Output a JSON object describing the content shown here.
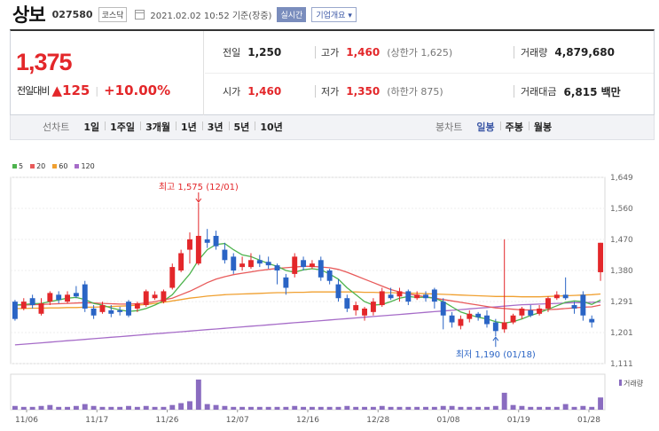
{
  "header": {
    "name": "상보",
    "code": "027580",
    "market": "코스닥",
    "datetime": "2021.02.02 10:52 기준(장중)",
    "realtime": "실시간",
    "overview": "기업개요"
  },
  "price": {
    "current": "1,375",
    "change_label": "전일대비",
    "change": "▲125",
    "change_pct": "+10.00%"
  },
  "info": {
    "prev_label": "전일",
    "prev": "1,250",
    "high_label": "고가",
    "high": "1,460",
    "high_sub": "(상한가 1,625)",
    "volume_label": "거래량",
    "volume": "4,879,680",
    "open_label": "시가",
    "open": "1,460",
    "low_label": "저가",
    "low": "1,350",
    "low_sub": "(하한가 875)",
    "amount_label": "거래대금",
    "amount": "6,815 백만"
  },
  "tabs": {
    "line_label": "선차트",
    "line_items": [
      "1일",
      "1주일",
      "3개월",
      "1년",
      "3년",
      "5년",
      "10년"
    ],
    "candle_label": "봉차트",
    "candle_items": [
      "일봉",
      "주봉",
      "월봉"
    ],
    "candle_active": "일봉"
  },
  "colors": {
    "up": "#e3272a",
    "down": "#2a64c5",
    "ma5": "#4db34d",
    "ma20": "#e85a5a",
    "ma60": "#f0a030",
    "ma120": "#a66cc8",
    "volume": "#8a6cc0"
  },
  "chart_data": {
    "type": "candlestick",
    "legend": [
      "5",
      "20",
      "60",
      "120"
    ],
    "yticks": [
      "1,649",
      "1,560",
      "1,470",
      "1,380",
      "1,291",
      "1,201",
      "1,111"
    ],
    "ylim": [
      1111,
      1649
    ],
    "xlabels": [
      "11/06",
      "11/17",
      "11/26",
      "12/07",
      "12/16",
      "12/28",
      "01/08",
      "01/19",
      "01/28"
    ],
    "max_annotation": "최고 1,575 (12/01)",
    "min_annotation": "최저 1,190 (01/18)",
    "volume_label": "거래량",
    "candles": [
      [
        1290,
        1240,
        1295,
        1235
      ],
      [
        1270,
        1290,
        1300,
        1265
      ],
      [
        1300,
        1280,
        1310,
        1270
      ],
      [
        1255,
        1285,
        1300,
        1250
      ],
      [
        1290,
        1315,
        1320,
        1280
      ],
      [
        1310,
        1295,
        1320,
        1285
      ],
      [
        1290,
        1310,
        1320,
        1285
      ],
      [
        1315,
        1305,
        1335,
        1300
      ],
      [
        1340,
        1270,
        1350,
        1260
      ],
      [
        1270,
        1250,
        1280,
        1240
      ],
      [
        1260,
        1280,
        1290,
        1255
      ],
      [
        1265,
        1255,
        1280,
        1245
      ],
      [
        1265,
        1260,
        1275,
        1250
      ],
      [
        1290,
        1250,
        1295,
        1245
      ],
      [
        1270,
        1285,
        1290,
        1260
      ],
      [
        1280,
        1320,
        1325,
        1275
      ],
      [
        1300,
        1310,
        1320,
        1295
      ],
      [
        1290,
        1320,
        1325,
        1285
      ],
      [
        1330,
        1390,
        1400,
        1325
      ],
      [
        1380,
        1430,
        1440,
        1375
      ],
      [
        1440,
        1470,
        1490,
        1400
      ],
      [
        1400,
        1480,
        1575,
        1395
      ],
      [
        1470,
        1460,
        1500,
        1445
      ],
      [
        1480,
        1450,
        1495,
        1440
      ],
      [
        1440,
        1410,
        1460,
        1400
      ],
      [
        1420,
        1380,
        1430,
        1370
      ],
      [
        1390,
        1400,
        1420,
        1380
      ],
      [
        1390,
        1410,
        1430,
        1385
      ],
      [
        1410,
        1400,
        1425,
        1390
      ],
      [
        1405,
        1395,
        1420,
        1385
      ],
      [
        1395,
        1380,
        1400,
        1340
      ],
      [
        1360,
        1330,
        1370,
        1310
      ],
      [
        1370,
        1420,
        1430,
        1360
      ],
      [
        1410,
        1390,
        1420,
        1380
      ],
      [
        1390,
        1400,
        1410,
        1385
      ],
      [
        1410,
        1360,
        1420,
        1350
      ],
      [
        1380,
        1350,
        1385,
        1340
      ],
      [
        1340,
        1300,
        1355,
        1290
      ],
      [
        1300,
        1270,
        1310,
        1260
      ],
      [
        1265,
        1280,
        1290,
        1250
      ],
      [
        1250,
        1270,
        1275,
        1235
      ],
      [
        1260,
        1290,
        1300,
        1250
      ],
      [
        1280,
        1320,
        1330,
        1275
      ],
      [
        1310,
        1300,
        1330,
        1295
      ],
      [
        1305,
        1320,
        1330,
        1290
      ],
      [
        1320,
        1290,
        1325,
        1280
      ],
      [
        1300,
        1310,
        1320,
        1295
      ],
      [
        1310,
        1300,
        1320,
        1290
      ],
      [
        1325,
        1290,
        1330,
        1270
      ],
      [
        1290,
        1250,
        1300,
        1210
      ],
      [
        1250,
        1230,
        1260,
        1215
      ],
      [
        1220,
        1240,
        1250,
        1210
      ],
      [
        1240,
        1255,
        1265,
        1230
      ],
      [
        1255,
        1245,
        1260,
        1235
      ],
      [
        1250,
        1225,
        1265,
        1215
      ],
      [
        1230,
        1205,
        1240,
        1190
      ],
      [
        1210,
        1230,
        1470,
        1200
      ],
      [
        1230,
        1250,
        1255,
        1225
      ],
      [
        1250,
        1270,
        1275,
        1240
      ],
      [
        1265,
        1250,
        1280,
        1245
      ],
      [
        1255,
        1270,
        1280,
        1250
      ],
      [
        1270,
        1300,
        1305,
        1260
      ],
      [
        1300,
        1310,
        1320,
        1295
      ],
      [
        1310,
        1300,
        1360,
        1295
      ],
      [
        1280,
        1270,
        1290,
        1255
      ],
      [
        1310,
        1250,
        1320,
        1235
      ],
      [
        1240,
        1230,
        1250,
        1215
      ],
      [
        1375,
        1460,
        1460,
        1350
      ]
    ],
    "ma5": [
      1280,
      1282,
      1284,
      1285,
      1290,
      1295,
      1300,
      1302,
      1296,
      1285,
      1280,
      1272,
      1266,
      1262,
      1264,
      1270,
      1280,
      1292,
      1310,
      1340,
      1370,
      1410,
      1440,
      1455,
      1458,
      1440,
      1425,
      1420,
      1410,
      1400,
      1392,
      1380,
      1375,
      1382,
      1385,
      1382,
      1370,
      1355,
      1330,
      1310,
      1290,
      1280,
      1282,
      1290,
      1300,
      1305,
      1302,
      1303,
      1300,
      1290,
      1275,
      1260,
      1252,
      1245,
      1240,
      1232,
      1228,
      1232,
      1240,
      1250,
      1258,
      1268,
      1278,
      1288,
      1292,
      1290,
      1282,
      1295
    ],
    "ma20": [
      1280,
      1280,
      1281,
      1282,
      1283,
      1284,
      1285,
      1286,
      1287,
      1286,
      1285,
      1284,
      1283,
      1283,
      1284,
      1286,
      1290,
      1295,
      1300,
      1310,
      1320,
      1332,
      1345,
      1355,
      1362,
      1368,
      1372,
      1376,
      1380,
      1383,
      1386,
      1388,
      1390,
      1392,
      1392,
      1390,
      1388,
      1383,
      1375,
      1365,
      1355,
      1345,
      1335,
      1325,
      1318,
      1312,
      1308,
      1304,
      1300,
      1296,
      1292,
      1288,
      1284,
      1280,
      1276,
      1272,
      1270,
      1268,
      1266,
      1266,
      1266,
      1267,
      1268,
      1270,
      1272,
      1274,
      1275,
      1280
    ],
    "ma60": [
      1270,
      1270,
      1271,
      1271,
      1272,
      1272,
      1273,
      1273,
      1274,
      1274,
      1275,
      1276,
      1277,
      1278,
      1280,
      1282,
      1285,
      1288,
      1292,
      1296,
      1300,
      1303,
      1306,
      1308,
      1310,
      1311,
      1312,
      1313,
      1314,
      1315,
      1316,
      1316,
      1317,
      1317,
      1318,
      1318,
      1318,
      1318,
      1318,
      1318,
      1317,
      1317,
      1316,
      1316,
      1315,
      1315,
      1314,
      1313,
      1312,
      1311,
      1310,
      1309,
      1308,
      1307,
      1306,
      1305,
      1305,
      1305,
      1304,
      1304,
      1304,
      1305,
      1306,
      1307,
      1308,
      1309,
      1310,
      1312
    ],
    "ma120": [
      1165,
      1167,
      1169,
      1171,
      1173,
      1175,
      1177,
      1179,
      1181,
      1183,
      1185,
      1187,
      1189,
      1191,
      1193,
      1195,
      1197,
      1199,
      1201,
      1203,
      1205,
      1207,
      1209,
      1211,
      1213,
      1215,
      1217,
      1219,
      1221,
      1223,
      1225,
      1227,
      1229,
      1231,
      1233,
      1235,
      1237,
      1239,
      1241,
      1243,
      1245,
      1247,
      1249,
      1251,
      1253,
      1255,
      1257,
      1259,
      1261,
      1263,
      1265,
      1267,
      1269,
      1271,
      1273,
      1275,
      1277,
      1279,
      1281,
      1282,
      1283,
      1284,
      1285,
      1286,
      1287,
      1287,
      1288,
      1289
    ],
    "volume": [
      4,
      3,
      3,
      4,
      5,
      3,
      3,
      4,
      6,
      4,
      3,
      3,
      3,
      4,
      3,
      4,
      3,
      3,
      5,
      7,
      9,
      32,
      6,
      5,
      4,
      3,
      3,
      3,
      3,
      3,
      3,
      3,
      4,
      3,
      3,
      3,
      3,
      3,
      4,
      3,
      3,
      3,
      4,
      3,
      3,
      3,
      3,
      3,
      3,
      4,
      4,
      3,
      3,
      3,
      3,
      4,
      18,
      5,
      4,
      3,
      3,
      3,
      3,
      6,
      3,
      4,
      3,
      13
    ]
  }
}
